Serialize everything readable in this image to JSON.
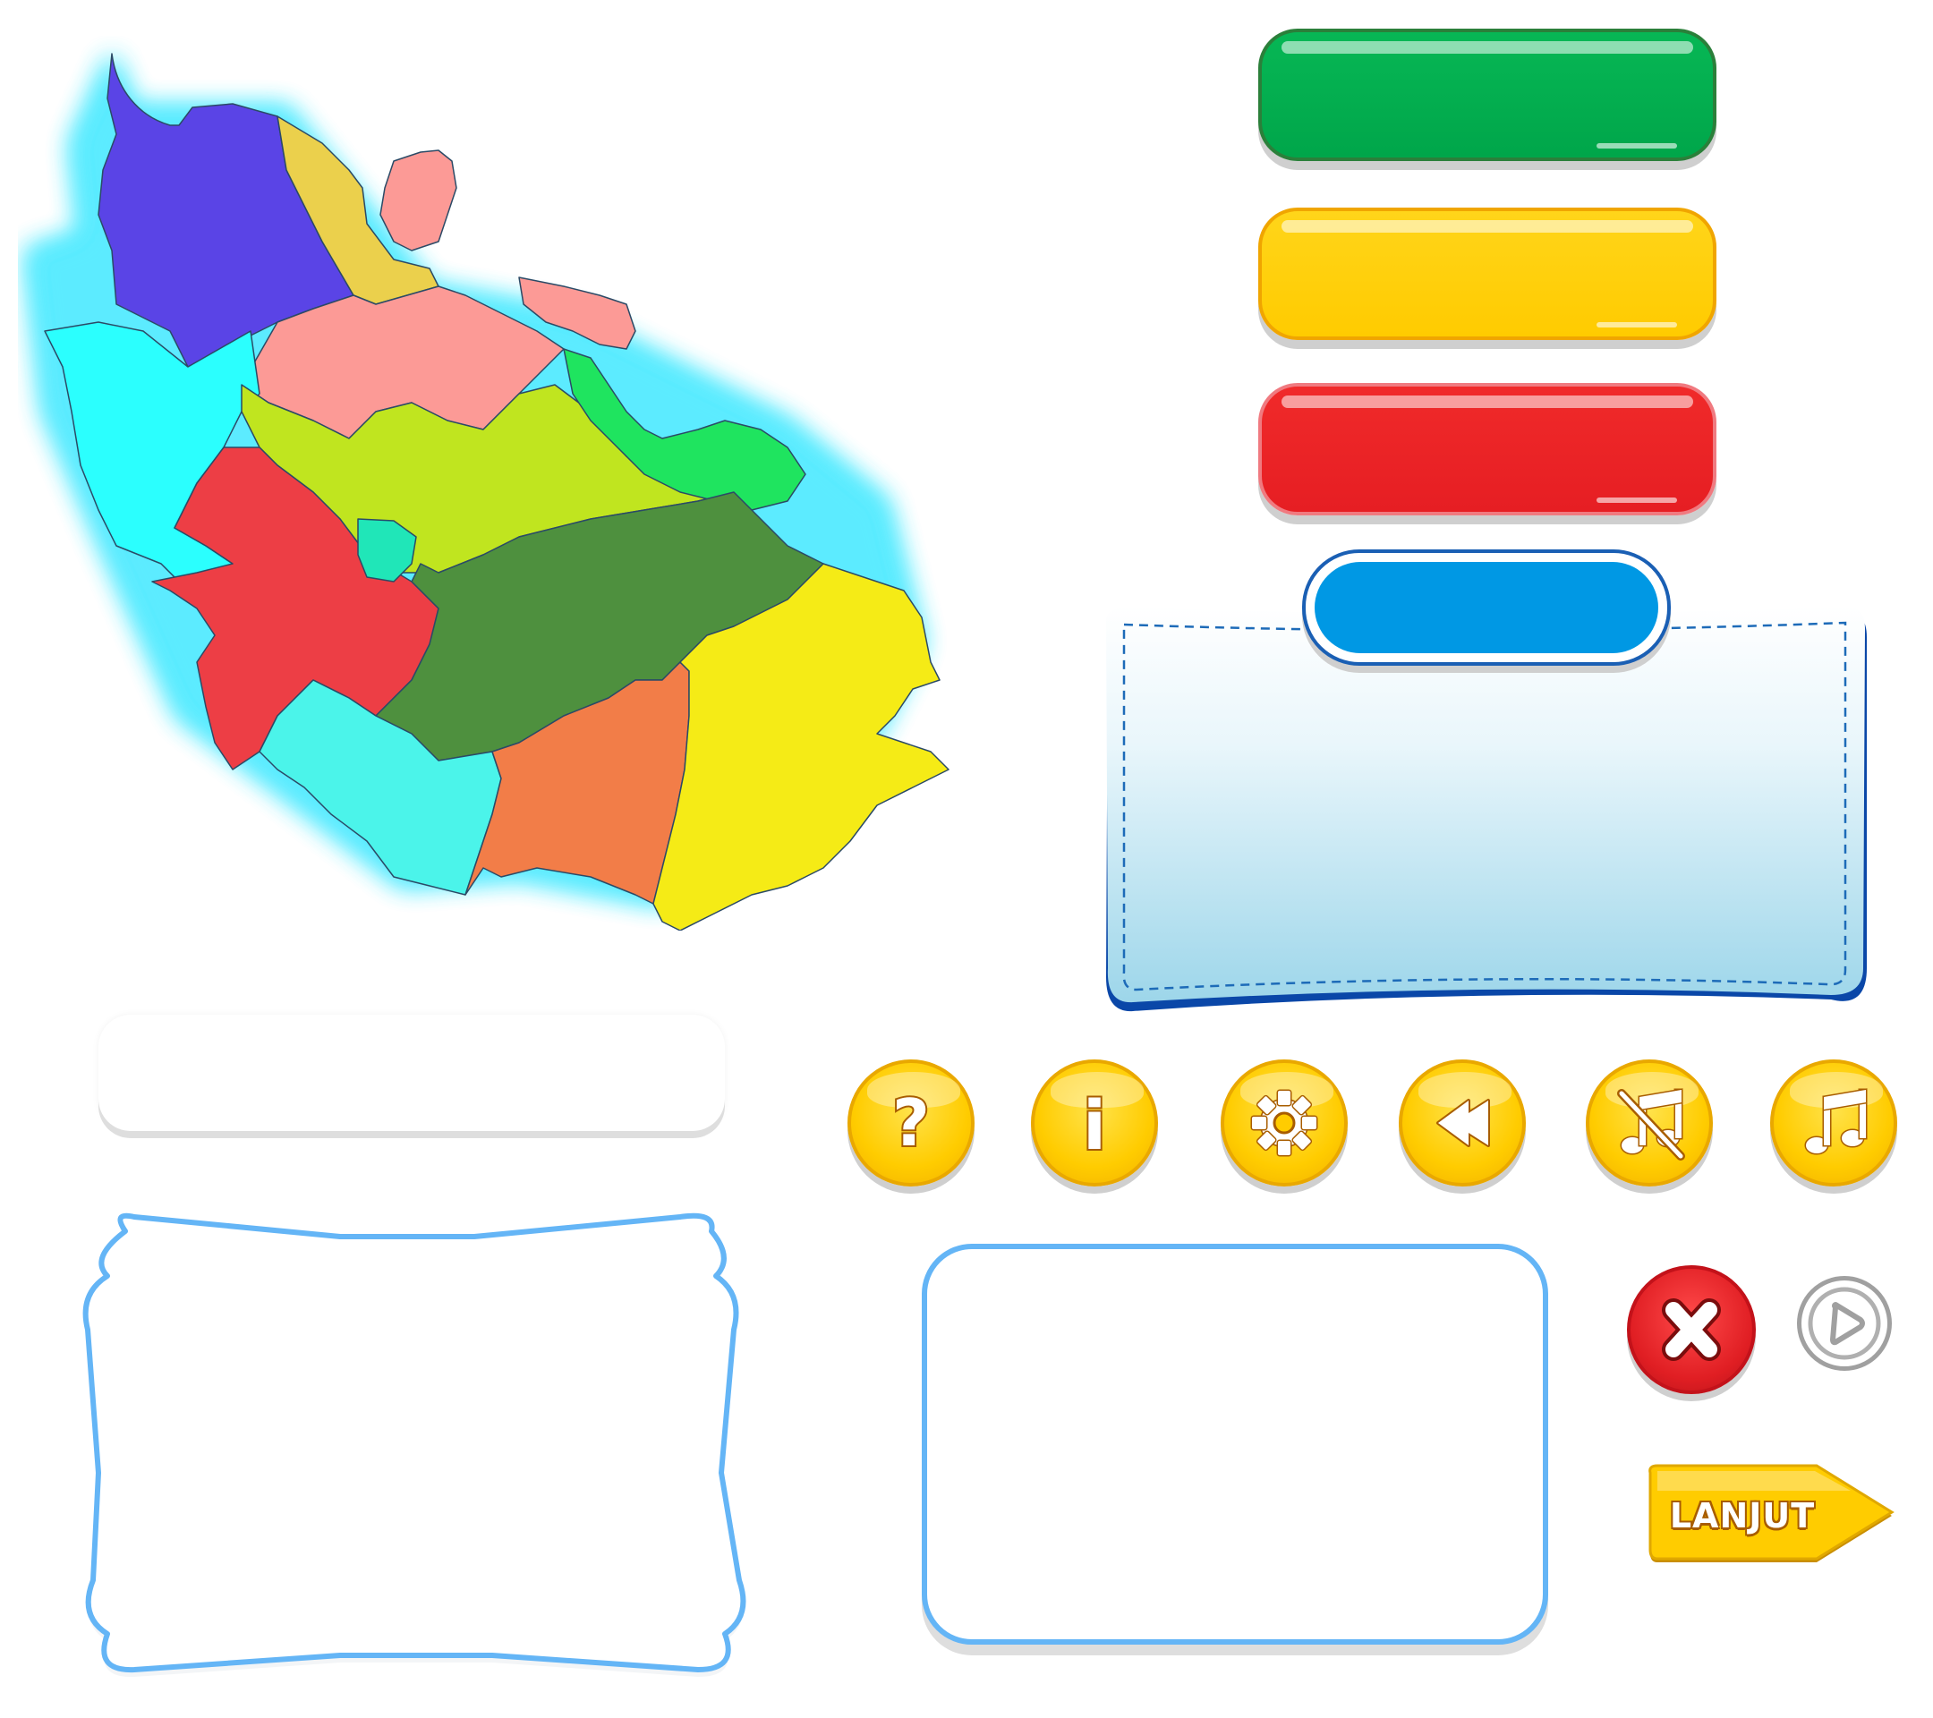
{
  "map": {
    "glow_color": "#40e8ff",
    "regions": [
      {
        "id": "region-north-purple",
        "color": "#5a44e6"
      },
      {
        "id": "region-north-gold",
        "color": "#ebd04c"
      },
      {
        "id": "region-island-pink",
        "color": "#fc9a96"
      },
      {
        "id": "region-pink-central",
        "color": "#fc9a96"
      },
      {
        "id": "region-island-pink-small",
        "color": "#fc9a96"
      },
      {
        "id": "region-west-cyan",
        "color": "#2bfffe"
      },
      {
        "id": "region-lime",
        "color": "#c0e51f"
      },
      {
        "id": "region-red",
        "color": "#ed3e45"
      },
      {
        "id": "region-teal-small",
        "color": "#20e6b8"
      },
      {
        "id": "region-islands-green",
        "color": "#1fe45f"
      },
      {
        "id": "region-dark-green",
        "color": "#4e903e"
      },
      {
        "id": "region-south-cyan",
        "color": "#4bf4ea"
      },
      {
        "id": "region-orange",
        "color": "#f27d48"
      },
      {
        "id": "region-east-yellow",
        "color": "#f5eb16"
      }
    ]
  },
  "buttons": {
    "green_color": "#00a64a",
    "yellow_color": "#ffcc00",
    "red_color": "#e61e23",
    "blue_tab_color": "#0098e4"
  },
  "icons": [
    {
      "name": "help-icon"
    },
    {
      "name": "info-icon"
    },
    {
      "name": "gear-icon"
    },
    {
      "name": "back-icon"
    },
    {
      "name": "music-off-icon"
    },
    {
      "name": "music-icon"
    }
  ],
  "close_icon": "close-icon",
  "play_icon": "play-icon",
  "lanjut": {
    "label": "LANJUT",
    "color": "#ffcc00"
  },
  "frames": {
    "border_color": "#64b5f6"
  }
}
